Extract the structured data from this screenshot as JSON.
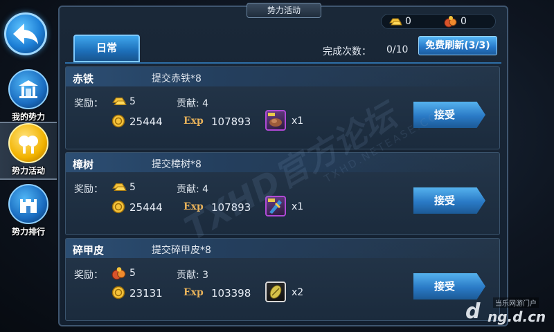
{
  "nav": {
    "items": [
      {
        "label": "我的势力",
        "icon": "pavilion-icon"
      },
      {
        "label": "势力活动",
        "icon": "cheer-icon"
      },
      {
        "label": "势力排行",
        "icon": "rank-castle-icon"
      }
    ]
  },
  "header": {
    "title": "势力活动",
    "currency": [
      {
        "icon": "gold-ingot-icon",
        "value": "0"
      },
      {
        "icon": "gift-bag-icon",
        "value": "0"
      }
    ]
  },
  "tabs": [
    {
      "label": "日常",
      "active": true
    }
  ],
  "progress": {
    "label": "完成次数：",
    "value": "0/10"
  },
  "refresh_button": "免费刷新(3/3)",
  "quests": [
    {
      "name": "赤铁",
      "task": "提交赤铁*8",
      "reward_label": "奖励：",
      "reward_icon": "gold-ingot-icon",
      "reward_value": "5",
      "contribution": "贡献: 4",
      "coins": "25444",
      "exp_label": "Exp",
      "exp": "107893",
      "item_icon": "red-iron-icon",
      "item_qty": "x1",
      "accept": "接受"
    },
    {
      "name": "樟树",
      "task": "提交樟树*8",
      "reward_label": "奖励：",
      "reward_icon": "gold-ingot-icon",
      "reward_value": "5",
      "contribution": "贡献: 4",
      "coins": "25444",
      "exp_label": "Exp",
      "exp": "107893",
      "item_icon": "camphor-wood-icon",
      "item_qty": "x1",
      "accept": "接受"
    },
    {
      "name": "碎甲皮",
      "task": "提交碎甲皮*8",
      "reward_label": "奖励：",
      "reward_icon": "gift-bag-icon",
      "reward_value": "5",
      "contribution": "贡献: 3",
      "coins": "23131",
      "exp_label": "Exp",
      "exp": "103398",
      "item_icon": "armor-hide-icon",
      "item_qty": "x2",
      "accept": "接受"
    }
  ],
  "watermark": {
    "main": "TXHD官方论坛",
    "sub": "TXHD.NETEASE.COM"
  },
  "site": {
    "badge": "当乐网游门户",
    "url": "ng.d.cn",
    "logo": "d"
  }
}
